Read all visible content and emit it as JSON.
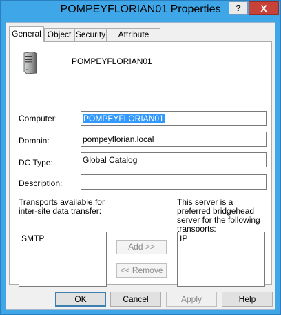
{
  "window": {
    "title": "POMPEYFLORIAN01 Properties",
    "help_glyph": "?",
    "close_glyph": "X"
  },
  "tabs": [
    {
      "label": "General",
      "active": true
    },
    {
      "label": "Object",
      "active": false
    },
    {
      "label": "Security",
      "active": false
    },
    {
      "label": "Attribute Editor",
      "active": false
    }
  ],
  "general": {
    "server_name": "POMPEYFLORIAN01",
    "computer_label": "Computer:",
    "computer_value": "POMPEYFLORIAN01",
    "domain_label": "Domain:",
    "domain_value": "pompeyflorian.local",
    "dctype_label": "DC Type:",
    "dctype_value": "Global Catalog",
    "description_label": "Description:",
    "description_value": "",
    "transports_label": "Transports available for inter-site data transfer:",
    "bridgehead_label": "This server is a preferred bridgehead server for the following transports:",
    "available_transports": [
      "SMTP"
    ],
    "bridgehead_transports": [
      "IP"
    ],
    "add_label": "Add >>",
    "remove_label": "<< Remove"
  },
  "footer": {
    "ok": "OK",
    "cancel": "Cancel",
    "apply": "Apply",
    "help": "Help"
  },
  "colors": {
    "title_bar": "#3fa6e8",
    "close_button": "#c7433a",
    "selection": "#3399ff",
    "default_button_border": "#3c7fb1"
  }
}
